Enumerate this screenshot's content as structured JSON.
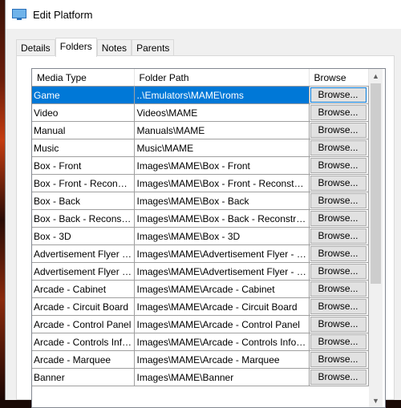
{
  "window": {
    "title": "Edit Platform",
    "icon": "monitor-icon"
  },
  "tabs": [
    {
      "label": "Details",
      "active": false
    },
    {
      "label": "Folders",
      "active": true
    },
    {
      "label": "Notes",
      "active": false
    },
    {
      "label": "Parents",
      "active": false
    }
  ],
  "grid": {
    "columns": [
      "Media Type",
      "Folder Path",
      "Browse"
    ],
    "browse_label": "Browse...",
    "selected_index": 0,
    "rows": [
      {
        "media_type": "Game",
        "folder_path": "..\\Emulators\\MAME\\roms"
      },
      {
        "media_type": "Video",
        "folder_path": "Videos\\MAME"
      },
      {
        "media_type": "Manual",
        "folder_path": "Manuals\\MAME"
      },
      {
        "media_type": "Music",
        "folder_path": "Music\\MAME"
      },
      {
        "media_type": "Box - Front",
        "folder_path": "Images\\MAME\\Box - Front"
      },
      {
        "media_type": "Box - Front - Reconstruct...",
        "folder_path": "Images\\MAME\\Box - Front - Reconstructed"
      },
      {
        "media_type": "Box - Back",
        "folder_path": "Images\\MAME\\Box - Back"
      },
      {
        "media_type": "Box - Back - Reconstru...",
        "folder_path": "Images\\MAME\\Box - Back - Reconstructed"
      },
      {
        "media_type": "Box - 3D",
        "folder_path": "Images\\MAME\\Box - 3D"
      },
      {
        "media_type": "Advertisement Flyer - ...",
        "folder_path": "Images\\MAME\\Advertisement Flyer - Front"
      },
      {
        "media_type": "Advertisement Flyer - ...",
        "folder_path": "Images\\MAME\\Advertisement Flyer - Back"
      },
      {
        "media_type": "Arcade - Cabinet",
        "folder_path": "Images\\MAME\\Arcade - Cabinet"
      },
      {
        "media_type": "Arcade - Circuit Board",
        "folder_path": "Images\\MAME\\Arcade - Circuit Board"
      },
      {
        "media_type": "Arcade - Control Panel",
        "folder_path": "Images\\MAME\\Arcade - Control Panel"
      },
      {
        "media_type": "Arcade - Controls Info...",
        "folder_path": "Images\\MAME\\Arcade - Controls Informat..."
      },
      {
        "media_type": "Arcade - Marquee",
        "folder_path": "Images\\MAME\\Arcade - Marquee"
      },
      {
        "media_type": "Banner",
        "folder_path": "Images\\MAME\\Banner"
      }
    ]
  }
}
